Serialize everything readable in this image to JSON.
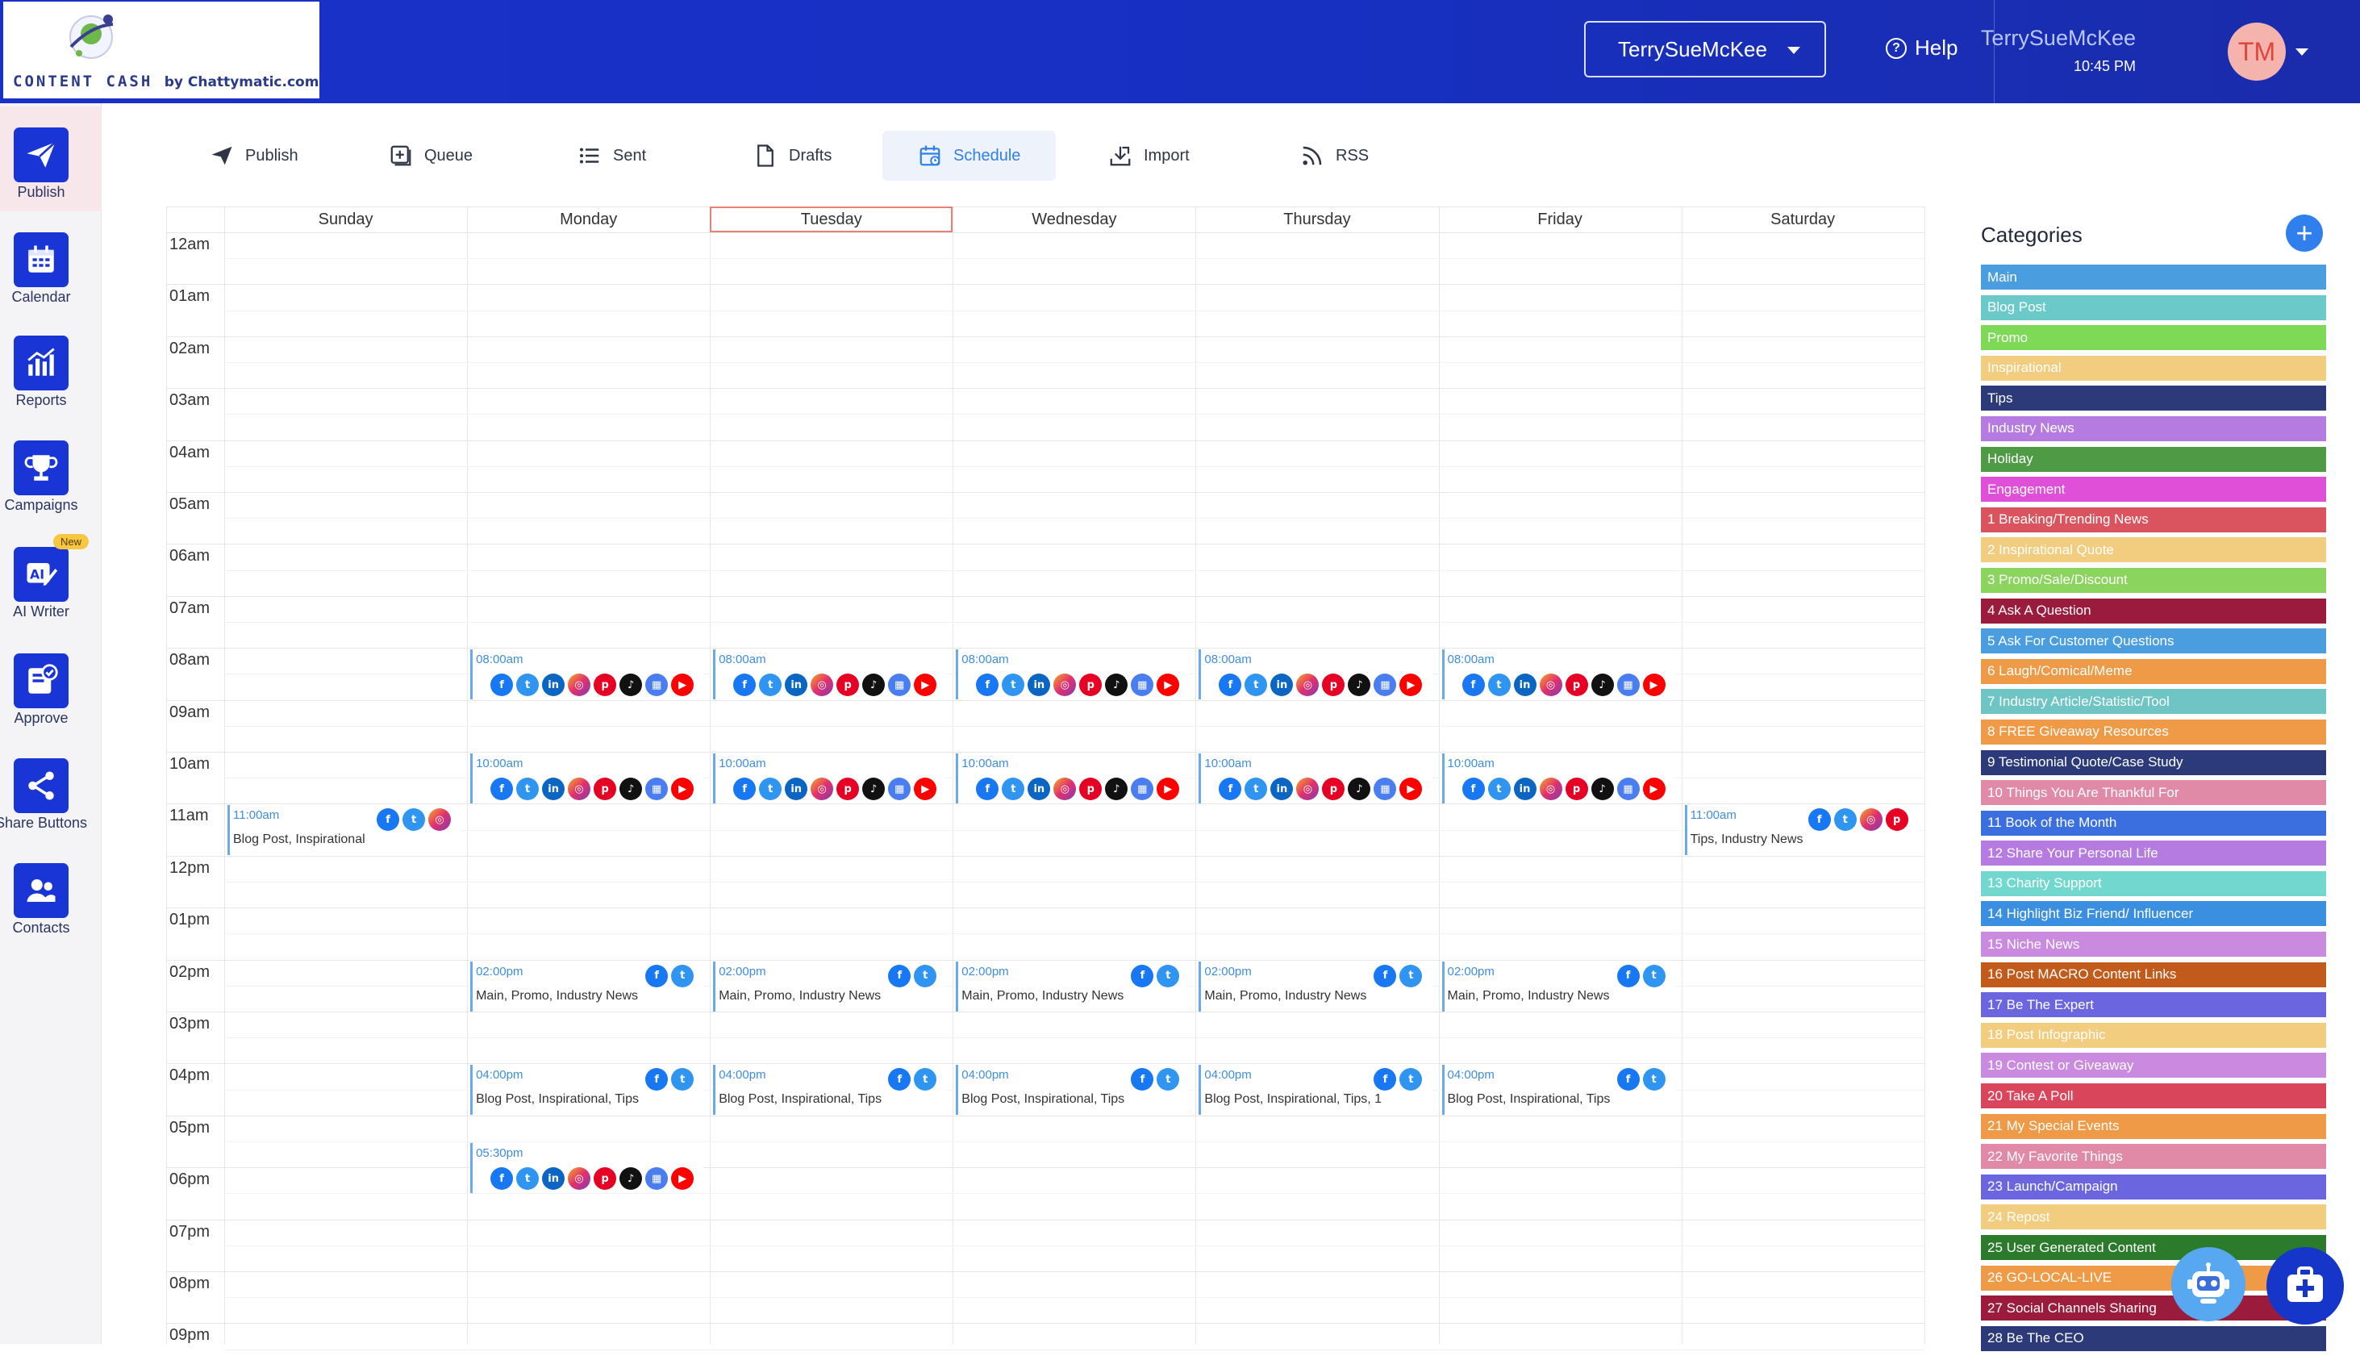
{
  "brand": {
    "logo_text": "CONTENT CASH",
    "logo_suffix": "by Chattymatic.com"
  },
  "header": {
    "account_select": "TerrySueMcKee",
    "help_label": "Help",
    "user_name": "TerrySueMcKee",
    "user_time": "10:45 PM",
    "avatar_initials": "TM"
  },
  "sidebar": {
    "items": [
      {
        "label": "Publish",
        "icon": "paper-plane-icon"
      },
      {
        "label": "Calendar",
        "icon": "calendar-icon"
      },
      {
        "label": "Reports",
        "icon": "bar-chart-icon"
      },
      {
        "label": "Campaigns",
        "icon": "trophy-icon"
      },
      {
        "label": "AI Writer",
        "icon": "ai-writer-icon",
        "badge": "New"
      },
      {
        "label": "Approve",
        "icon": "approve-icon"
      },
      {
        "label": "Share Buttons",
        "icon": "share-icon"
      },
      {
        "label": "Contacts",
        "icon": "contacts-icon"
      }
    ]
  },
  "tabs": [
    {
      "label": "Publish",
      "icon": "paper-plane-icon"
    },
    {
      "label": "Queue",
      "icon": "queue-icon"
    },
    {
      "label": "Sent",
      "icon": "list-icon"
    },
    {
      "label": "Drafts",
      "icon": "document-icon"
    },
    {
      "label": "Schedule",
      "icon": "calendar-icon",
      "active": true
    },
    {
      "label": "Import",
      "icon": "import-icon"
    },
    {
      "label": "RSS",
      "icon": "rss-icon"
    }
  ],
  "calendar": {
    "days": [
      "Sunday",
      "Monday",
      "Tuesday",
      "Wednesday",
      "Thursday",
      "Friday",
      "Saturday"
    ],
    "today_index": 2,
    "hours": [
      "12am",
      "01am",
      "02am",
      "03am",
      "04am",
      "05am",
      "06am",
      "07am",
      "08am",
      "09am",
      "10am",
      "11am",
      "12pm",
      "01pm",
      "02pm",
      "03pm",
      "04pm",
      "05pm",
      "06pm",
      "07pm",
      "08pm",
      "09pm"
    ],
    "events": [
      {
        "day": 1,
        "hour": 8,
        "time": "08:00am",
        "cats": "",
        "icons": [
          "fb",
          "tw",
          "li",
          "ig",
          "pi",
          "tk",
          "gb",
          "yt"
        ]
      },
      {
        "day": 2,
        "hour": 8,
        "time": "08:00am",
        "cats": "",
        "icons": [
          "fb",
          "tw",
          "li",
          "ig",
          "pi",
          "tk",
          "gb",
          "yt"
        ]
      },
      {
        "day": 3,
        "hour": 8,
        "time": "08:00am",
        "cats": "",
        "icons": [
          "fb",
          "tw",
          "li",
          "ig",
          "pi",
          "tk",
          "gb",
          "yt"
        ]
      },
      {
        "day": 4,
        "hour": 8,
        "time": "08:00am",
        "cats": "",
        "icons": [
          "fb",
          "tw",
          "li",
          "ig",
          "pi",
          "tk",
          "gb",
          "yt"
        ]
      },
      {
        "day": 5,
        "hour": 8,
        "time": "08:00am",
        "cats": "",
        "icons": [
          "fb",
          "tw",
          "li",
          "ig",
          "pi",
          "tk",
          "gb",
          "yt"
        ]
      },
      {
        "day": 1,
        "hour": 10,
        "time": "10:00am",
        "cats": "",
        "icons": [
          "fb",
          "tw",
          "li",
          "ig",
          "pi",
          "tk",
          "gb",
          "yt"
        ]
      },
      {
        "day": 2,
        "hour": 10,
        "time": "10:00am",
        "cats": "",
        "icons": [
          "fb",
          "tw",
          "li",
          "ig",
          "pi",
          "tk",
          "gb",
          "yt"
        ]
      },
      {
        "day": 3,
        "hour": 10,
        "time": "10:00am",
        "cats": "",
        "icons": [
          "fb",
          "tw",
          "li",
          "ig",
          "pi",
          "tk",
          "gb",
          "yt"
        ]
      },
      {
        "day": 4,
        "hour": 10,
        "time": "10:00am",
        "cats": "",
        "icons": [
          "fb",
          "tw",
          "li",
          "ig",
          "pi",
          "tk",
          "gb",
          "yt"
        ]
      },
      {
        "day": 5,
        "hour": 10,
        "time": "10:00am",
        "cats": "",
        "icons": [
          "fb",
          "tw",
          "li",
          "ig",
          "pi",
          "tk",
          "gb",
          "yt"
        ]
      },
      {
        "day": 0,
        "hour": 11,
        "time": "11:00am",
        "cats": "Blog Post, Inspirational",
        "icons": [
          "fb",
          "tw",
          "ig"
        ]
      },
      {
        "day": 6,
        "hour": 11,
        "time": "11:00am",
        "cats": "Tips, Industry News",
        "icons": [
          "fb",
          "tw",
          "ig",
          "pi"
        ]
      },
      {
        "day": 1,
        "hour": 14,
        "time": "02:00pm",
        "cats": "Main, Promo, Industry News",
        "icons": [
          "fb",
          "tw"
        ]
      },
      {
        "day": 2,
        "hour": 14,
        "time": "02:00pm",
        "cats": "Main, Promo, Industry News",
        "icons": [
          "fb",
          "tw"
        ]
      },
      {
        "day": 3,
        "hour": 14,
        "time": "02:00pm",
        "cats": "Main, Promo, Industry News",
        "icons": [
          "fb",
          "tw"
        ]
      },
      {
        "day": 4,
        "hour": 14,
        "time": "02:00pm",
        "cats": "Main, Promo, Industry News",
        "icons": [
          "fb",
          "tw"
        ]
      },
      {
        "day": 5,
        "hour": 14,
        "time": "02:00pm",
        "cats": "Main, Promo, Industry News",
        "icons": [
          "fb",
          "tw"
        ]
      },
      {
        "day": 1,
        "hour": 16,
        "time": "04:00pm",
        "cats": "Blog Post, Inspirational, Tips",
        "icons": [
          "fb",
          "tw"
        ]
      },
      {
        "day": 2,
        "hour": 16,
        "time": "04:00pm",
        "cats": "Blog Post, Inspirational, Tips",
        "icons": [
          "fb",
          "tw"
        ]
      },
      {
        "day": 3,
        "hour": 16,
        "time": "04:00pm",
        "cats": "Blog Post, Inspirational, Tips",
        "icons": [
          "fb",
          "tw"
        ]
      },
      {
        "day": 4,
        "hour": 16,
        "time": "04:00pm",
        "cats": "Blog Post, Inspirational, Tips, 1",
        "icons": [
          "fb",
          "tw"
        ]
      },
      {
        "day": 5,
        "hour": 16,
        "time": "04:00pm",
        "cats": "Blog Post, Inspirational, Tips",
        "icons": [
          "fb",
          "tw"
        ]
      },
      {
        "day": 1,
        "hour": 17.5,
        "time": "05:30pm",
        "cats": "",
        "icons": [
          "fb",
          "tw",
          "li",
          "ig",
          "pi",
          "tk",
          "gb",
          "yt"
        ]
      }
    ]
  },
  "categories": {
    "title": "Categories",
    "items": [
      {
        "label": "Main",
        "color": "#4a9ee0"
      },
      {
        "label": "Blog Post",
        "color": "#6cc9c9"
      },
      {
        "label": "Promo",
        "color": "#7ed957"
      },
      {
        "label": "Inspirational",
        "color": "#f2cd7f"
      },
      {
        "label": "Tips",
        "color": "#2c3a7a"
      },
      {
        "label": "Industry News",
        "color": "#b57be0"
      },
      {
        "label": "Holiday",
        "color": "#4f9b45"
      },
      {
        "label": "Engagement",
        "color": "#e04fd8"
      },
      {
        "label": "1 Breaking/Trending News",
        "color": "#d9545f"
      },
      {
        "label": "2 Inspirational Quote",
        "color": "#f2cd7f"
      },
      {
        "label": "3 Promo/Sale/Discount",
        "color": "#8bd45e"
      },
      {
        "label": "4 Ask A Question",
        "color": "#9b1b3c"
      },
      {
        "label": "5 Ask For Customer Questions",
        "color": "#4a9ee0"
      },
      {
        "label": "6 Laugh/Comical/Meme",
        "color": "#ee9a46"
      },
      {
        "label": "7 Industry Article/Statistic/Tool",
        "color": "#6fc4c4"
      },
      {
        "label": "8 FREE Giveaway Resources",
        "color": "#ee9a46"
      },
      {
        "label": "9 Testimonial Quote/Case Study",
        "color": "#2c3a7a"
      },
      {
        "label": "10 Things You Are Thankful For",
        "color": "#e08aa8"
      },
      {
        "label": "11 Book of the Month",
        "color": "#3b6fe0"
      },
      {
        "label": "12 Share Your Personal Life",
        "color": "#b57be0"
      },
      {
        "label": "13 Charity Support",
        "color": "#72d8cf"
      },
      {
        "label": "14 Highlight Biz Friend/ Influencer",
        "color": "#3b8fe0"
      },
      {
        "label": "15 Niche News",
        "color": "#c98ae0"
      },
      {
        "label": "16 Post MACRO Content Links",
        "color": "#c15a1a"
      },
      {
        "label": "17 Be The Expert",
        "color": "#6b66e0"
      },
      {
        "label": "18 Post Infographic",
        "color": "#f2cd7f"
      },
      {
        "label": "19 Contest or Giveaway",
        "color": "#c98ae0"
      },
      {
        "label": "20 Take A Poll",
        "color": "#d9455a"
      },
      {
        "label": "21 My Special Events",
        "color": "#ee9a46"
      },
      {
        "label": "22 My Favorite Things",
        "color": "#e08aa8"
      },
      {
        "label": "23 Launch/Campaign",
        "color": "#6b66e0"
      },
      {
        "label": "24 Repost",
        "color": "#f2cd7f"
      },
      {
        "label": "25 User Generated Content",
        "color": "#2c7a2c"
      },
      {
        "label": "26 GO-LOCAL-LIVE",
        "color": "#ee9a46"
      },
      {
        "label": "27 Social Channels Sharing",
        "color": "#9b1b3c"
      },
      {
        "label": "28 Be The CEO",
        "color": "#2c3a7a"
      }
    ]
  },
  "social_icons": {
    "fb": "f",
    "tw": "t",
    "li": "in",
    "ig": "◎",
    "pi": "p",
    "tk": "♪",
    "gb": "▦",
    "yt": "▶"
  },
  "colors": {
    "header_bg": "#1a31c9",
    "sidebar_icon_bg": "#1a35d6",
    "accent": "#2f80ed",
    "today_outline": "#e98074",
    "event_border": "#6aa9ec"
  }
}
